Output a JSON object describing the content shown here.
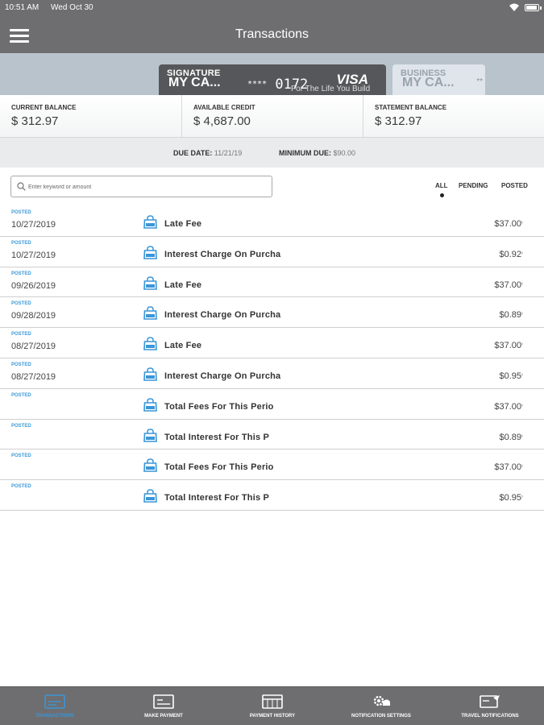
{
  "status_bar": {
    "time": "10:51 AM",
    "date": "Wed Oct 30"
  },
  "nav": {
    "title": "Transactions"
  },
  "cards": [
    {
      "type": "SIGNATURE",
      "name": "MY CA...",
      "masked": "****",
      "last4": "0172",
      "brand": "VISA",
      "tagline": "For The Life You Build"
    },
    {
      "type": "BUSINESS",
      "name": "MY CA...",
      "masked": "**"
    }
  ],
  "balances": {
    "current": {
      "label": "CURRENT BALANCE",
      "value": "$ 312.97"
    },
    "available": {
      "label": "AVAILABLE CREDIT",
      "value": "$ 4,687.00"
    },
    "statement": {
      "label": "STATEMENT BALANCE",
      "value": "$ 312.97"
    }
  },
  "due": {
    "due_label": "DUE DATE:",
    "due_value": "11/21/19",
    "min_label": "MINIMUM DUE:",
    "min_value": "$90.00"
  },
  "search": {
    "placeholder": "Enter keyword or amount"
  },
  "filters": {
    "all": "ALL",
    "pending": "PENDING",
    "posted": "POSTED",
    "active": "all"
  },
  "transactions": [
    {
      "status": "POSTED",
      "date": "10/27/2019",
      "description": "Late Fee",
      "amount": "$37.00"
    },
    {
      "status": "POSTED",
      "date": "10/27/2019",
      "description": "Interest Charge On Purcha",
      "amount": "$0.92"
    },
    {
      "status": "POSTED",
      "date": "09/26/2019",
      "description": "Late Fee",
      "amount": "$37.00"
    },
    {
      "status": "POSTED",
      "date": "09/28/2019",
      "description": "Interest Charge On Purcha",
      "amount": "$0.89"
    },
    {
      "status": "POSTED",
      "date": "08/27/2019",
      "description": "Late Fee",
      "amount": "$37.00"
    },
    {
      "status": "POSTED",
      "date": "08/27/2019",
      "description": "Interest Charge On Purcha",
      "amount": "$0.95"
    },
    {
      "status": "POSTED",
      "date": "",
      "description": "Total Fees For This Perio",
      "amount": "$37.00"
    },
    {
      "status": "POSTED",
      "date": "",
      "description": "Total Interest For This P",
      "amount": "$0.89"
    },
    {
      "status": "POSTED",
      "date": "",
      "description": "Total Fees For This Perio",
      "amount": "$37.00"
    },
    {
      "status": "POSTED",
      "date": "",
      "description": "Total Interest For This P",
      "amount": "$0.95"
    }
  ],
  "tabs": [
    {
      "label": "TRANSACTIONS",
      "icon": "transactions-icon"
    },
    {
      "label": "MAKE PAYMENT",
      "icon": "payment-icon"
    },
    {
      "label": "PAYMENT HISTORY",
      "icon": "history-icon"
    },
    {
      "label": "NOTIFICATION SETTINGS",
      "icon": "notification-settings-icon"
    },
    {
      "label": "TRAVEL NOTIFICATIONS",
      "icon": "travel-icon"
    }
  ],
  "colors": {
    "bar": "#6e6e70",
    "accent": "#3a96d8",
    "status_posted": "#3b9ad9",
    "carousel": "#b9c3cc"
  }
}
